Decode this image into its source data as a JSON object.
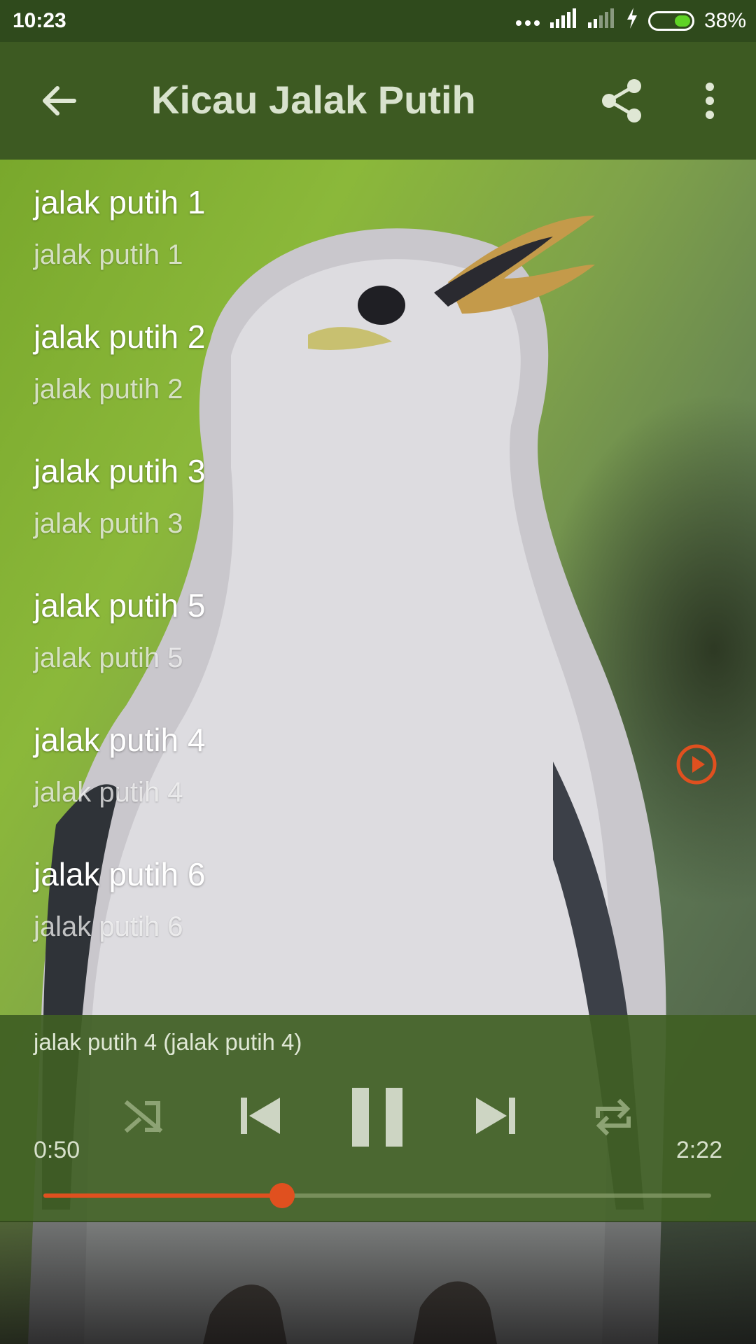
{
  "status_bar": {
    "time": "10:23",
    "battery": "38%",
    "battery_level": 0.38,
    "icons": [
      "more-dots-icon",
      "signal-icon",
      "signal-weak-icon",
      "charging-icon",
      "battery-icon"
    ]
  },
  "toolbar": {
    "title": "Kicau Jalak Putih",
    "icons": [
      "back-arrow-icon",
      "share-icon",
      "overflow-menu-icon"
    ]
  },
  "songs": [
    {
      "title": "jalak putih 1",
      "subtitle": "jalak putih 1"
    },
    {
      "title": "jalak putih 2",
      "subtitle": "jalak putih 2"
    },
    {
      "title": "jalak putih 3",
      "subtitle": "jalak putih 3"
    },
    {
      "title": "jalak putih 5",
      "subtitle": "jalak putih 5"
    },
    {
      "title": "jalak putih 4",
      "subtitle": "jalak putih 4",
      "playing": true
    },
    {
      "title": "jalak putih 6",
      "subtitle": "jalak putih 6"
    }
  ],
  "player": {
    "now_playing": "jalak putih 4 (jalak putih 4)",
    "current_time": "0:50",
    "total_time": "2:22",
    "progress": 0.357,
    "controls": [
      "shuffle-icon",
      "previous-icon",
      "pause-icon",
      "next-icon",
      "repeat-icon"
    ]
  },
  "colors": {
    "toolbar": "#3d5a22",
    "status_bar": "#2f4a1c",
    "accent": "#e0501f",
    "player_bg": "#405f23"
  }
}
